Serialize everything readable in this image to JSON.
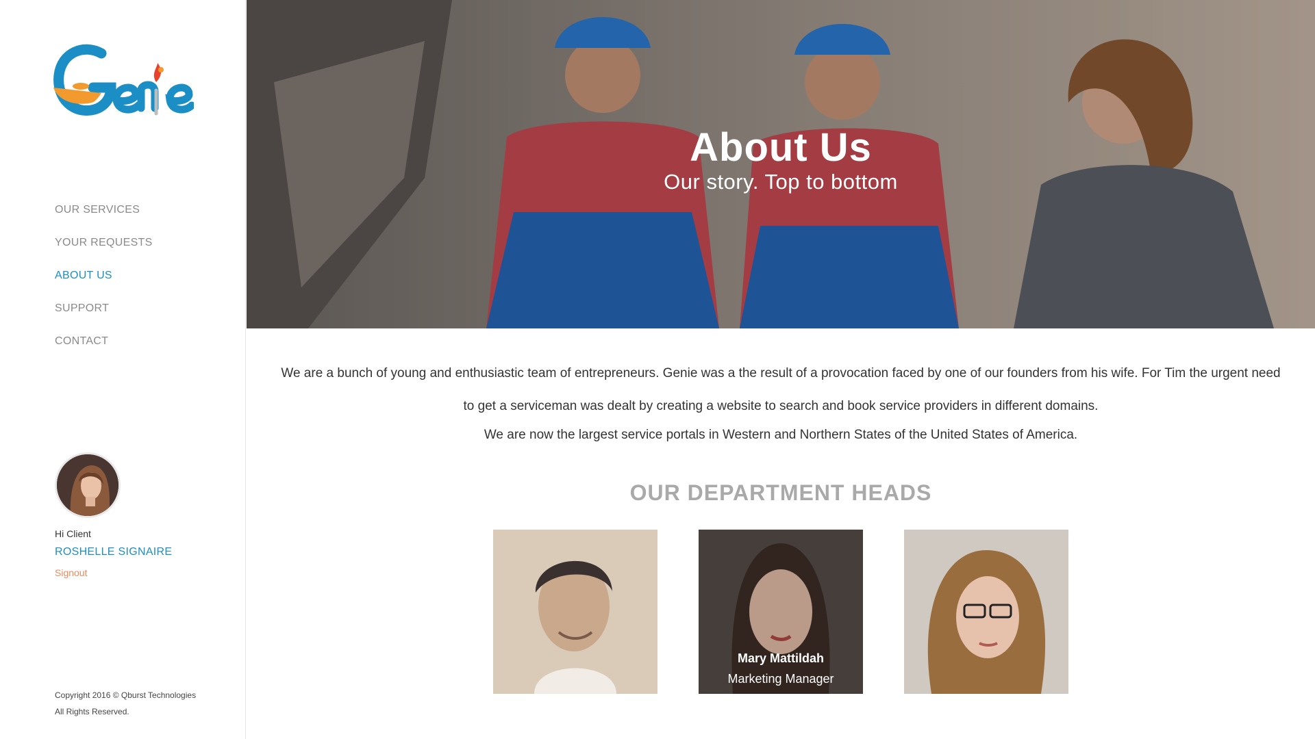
{
  "brand": {
    "logo_text": "Genie",
    "colors": {
      "blue": "#1b8ec6",
      "orange": "#f29a2e",
      "red": "#e8412c"
    }
  },
  "nav": {
    "items": [
      {
        "label": "OUR SERVICES",
        "active": false
      },
      {
        "label": "YOUR REQUESTS",
        "active": false
      },
      {
        "label": "ABOUT US",
        "active": true
      },
      {
        "label": "SUPPORT",
        "active": false
      },
      {
        "label": "CONTACT",
        "active": false
      }
    ]
  },
  "user": {
    "greeting": "Hi Client",
    "name": "ROSHELLE SIGNAIRE",
    "signout": "Signout"
  },
  "footer": {
    "line1": "Copyright 2016 © Qburst Technologies",
    "line2": "All Rights Reserved."
  },
  "hero": {
    "title": "About Us",
    "subtitle": "Our story. Top to bottom"
  },
  "intro": {
    "line1": "We are a bunch of young and enthusiastic team of entrepreneurs. Genie was a the result of a  provocation faced by one of our founders from his wife. For Tim the urgent need to get a serviceman was dealt by creating a website to search and book service providers in different domains.",
    "line2": "We are now the largest service portals in Western and Northern States of the United States of America."
  },
  "departments": {
    "title": "OUR DEPARTMENT HEADS",
    "heads": [
      {
        "name": "",
        "role": ""
      },
      {
        "name": "Mary Mattildah",
        "role": "Marketing Manager"
      },
      {
        "name": "",
        "role": ""
      }
    ]
  }
}
